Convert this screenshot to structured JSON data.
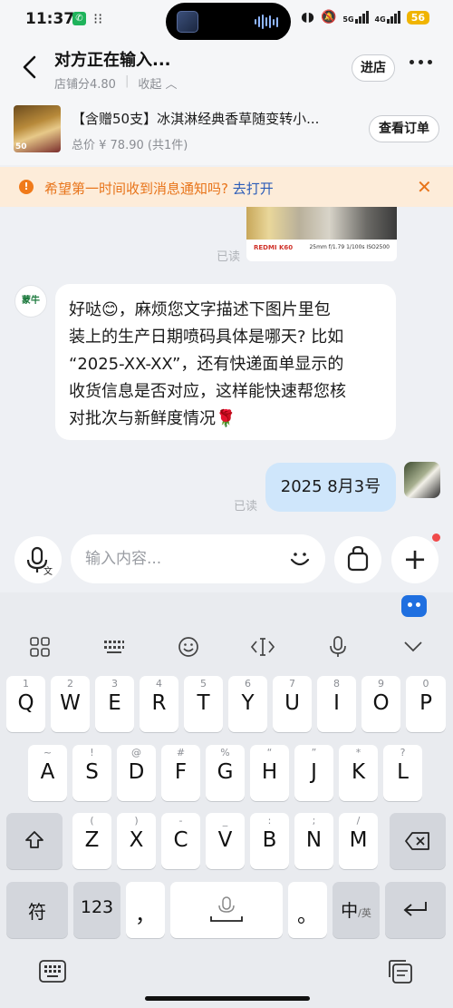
{
  "status_bar": {
    "time": "11:37",
    "battery": "56",
    "network_1": "5G",
    "network_2": "4G"
  },
  "header": {
    "title": "对方正在输入...",
    "store_score": "店铺分4.80",
    "collapse_label": "收起",
    "enter_store": "进店"
  },
  "product": {
    "title": "【含赠50支】冰淇淋经典香草随变转小...",
    "price": "总价 ¥ 78.90 (共1件)",
    "thumb_qty": "50",
    "view_order": "查看订单"
  },
  "notice": {
    "text": "希望第一时间收到消息通知吗?",
    "link": "去打开"
  },
  "chat": {
    "image_caption": "REDMI K60",
    "image_meta": "25mm  f/1.79  1/100s  ISO2500",
    "read_label_1": "已读",
    "shop_avatar_text": "蒙牛",
    "incoming_lines": [
      "好哒😊，麻烦您文字描述下图片里包",
      "装上的生产日期喷码具体是哪天? 比如",
      "“2025-XX-XX”，还有快递面单显示的",
      "收货信息是否对应，这样能快速帮您核",
      "对批次与新鲜度情况🌹"
    ],
    "outgoing": "2025 8月3号",
    "read_label_2": "已读"
  },
  "input_bar": {
    "placeholder": "输入内容..."
  },
  "keyboard": {
    "row1": [
      {
        "key": "Q",
        "sub": "1"
      },
      {
        "key": "W",
        "sub": "2"
      },
      {
        "key": "E",
        "sub": "3"
      },
      {
        "key": "R",
        "sub": "4"
      },
      {
        "key": "T",
        "sub": "5"
      },
      {
        "key": "Y",
        "sub": "6"
      },
      {
        "key": "U",
        "sub": "7"
      },
      {
        "key": "I",
        "sub": "8"
      },
      {
        "key": "O",
        "sub": "9"
      },
      {
        "key": "P",
        "sub": "0"
      }
    ],
    "row2": [
      {
        "key": "A",
        "sub": "~"
      },
      {
        "key": "S",
        "sub": "!"
      },
      {
        "key": "D",
        "sub": "@"
      },
      {
        "key": "F",
        "sub": "#"
      },
      {
        "key": "G",
        "sub": "%"
      },
      {
        "key": "H",
        "sub": "“"
      },
      {
        "key": "J",
        "sub": "”"
      },
      {
        "key": "K",
        "sub": "*"
      },
      {
        "key": "L",
        "sub": "?"
      }
    ],
    "row3": [
      {
        "key": "Z",
        "sub": "("
      },
      {
        "key": "X",
        "sub": ")"
      },
      {
        "key": "C",
        "sub": "-"
      },
      {
        "key": "V",
        "sub": "_"
      },
      {
        "key": "B",
        "sub": ":"
      },
      {
        "key": "N",
        "sub": ";"
      },
      {
        "key": "M",
        "sub": "/"
      }
    ],
    "symbol_key": "符",
    "num_key": "123",
    "comma_key": "，",
    "period_key": "。",
    "lang_key_main": "中",
    "lang_key_sub": "/英"
  }
}
